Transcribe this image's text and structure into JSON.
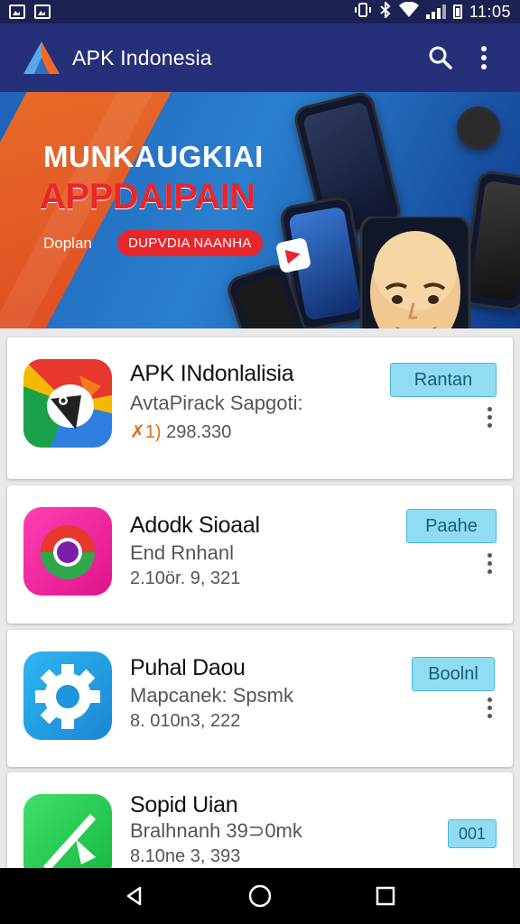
{
  "status_bar": {
    "time": "11:05",
    "icons": [
      "image-icon",
      "image-icon",
      "vibrate-icon",
      "bluetooth-icon",
      "wifi-icon",
      "signal-icon",
      "battery-icon"
    ]
  },
  "app_bar": {
    "title": "APK Indonesia",
    "icons": [
      "search-icon",
      "more-vert-icon"
    ]
  },
  "banner": {
    "headline": "MUNKAUGKIAI",
    "headline_red": "APPDAIPAIN",
    "caption": "Doplan",
    "pill": "DUPVDIA NAANHA"
  },
  "apps": [
    {
      "name": "APK INdonlalisia",
      "subtitle": "AvtaPirack Sapgoti:",
      "meta_accent": "✗1)",
      "meta": "298.330",
      "action": "Rantan",
      "icon": "parrot-icon"
    },
    {
      "name": "Adodk Sioaal",
      "subtitle": "End Rnhanl",
      "meta": "2.10ör. 9, 321",
      "action": "Paahe",
      "icon": "lens-icon"
    },
    {
      "name": "Puhal Daou",
      "subtitle": "Mapcanek: Spsmk",
      "meta": "8. 010n3, 222",
      "action": "Boolnl",
      "icon": "gear-icon"
    },
    {
      "name": "Sopid Uian",
      "subtitle": "Bralhnanh 39⊃0mk",
      "meta": "8.10ne 3, 393",
      "action": "001",
      "icon": "arrow-icon"
    }
  ],
  "nav_bar": {
    "buttons": [
      "back-icon",
      "home-icon",
      "recents-icon"
    ]
  },
  "colors": {
    "status_bar": "#1b2150",
    "app_bar": "#26307a",
    "action_bg": "#8fdcf3",
    "banner_red": "#e9262b",
    "banner_orange": "#f26a21"
  }
}
